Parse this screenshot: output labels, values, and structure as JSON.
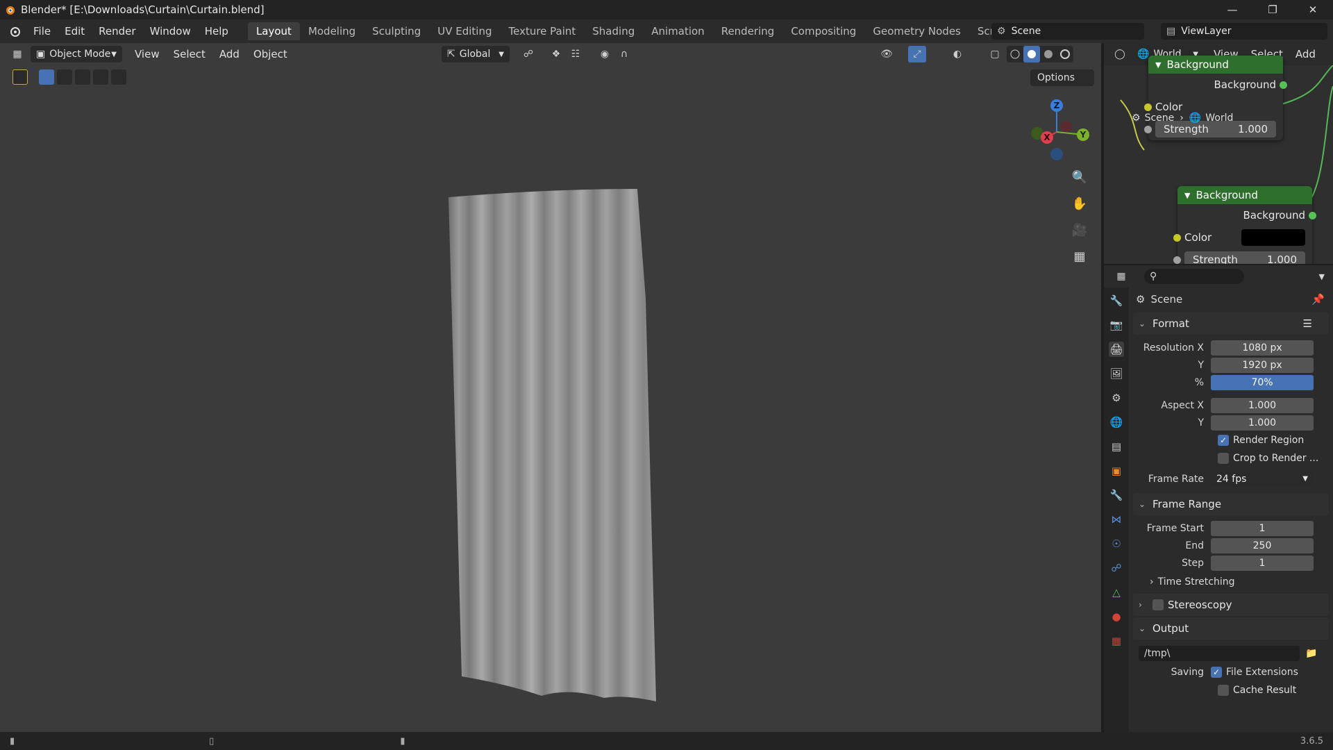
{
  "window": {
    "title": "Blender* [E:\\Downloads\\Curtain\\Curtain.blend]"
  },
  "menu": {
    "items": [
      "File",
      "Edit",
      "Render",
      "Window",
      "Help"
    ]
  },
  "workspaces": {
    "tabs": [
      "Layout",
      "Modeling",
      "Sculpting",
      "UV Editing",
      "Texture Paint",
      "Shading",
      "Animation",
      "Rendering",
      "Compositing",
      "Geometry Nodes",
      "Scripting"
    ],
    "active": "Layout"
  },
  "scene_selector": {
    "scene": "Scene",
    "view_layer": "ViewLayer"
  },
  "viewport": {
    "mode": "Object Mode",
    "menus": [
      "View",
      "Select",
      "Add",
      "Object"
    ],
    "transform_orientation": "Global",
    "options_label": "Options",
    "gizmo_axes": {
      "x": "X",
      "y": "Y",
      "z": "Z"
    }
  },
  "node_editor": {
    "world_type": "World",
    "menus": [
      "View",
      "Select",
      "Add"
    ],
    "breadcrumb": {
      "scene": "Scene",
      "world": "World"
    },
    "node1": {
      "title": "Background",
      "output": "Background",
      "color_label": "Color",
      "strength_label": "Strength",
      "strength_value": "1.000"
    },
    "node2": {
      "title": "Background",
      "output": "Background",
      "color_label": "Color",
      "strength_label": "Strength",
      "strength_value": "1.000"
    }
  },
  "properties": {
    "context": "Scene",
    "format": {
      "title": "Format",
      "res_x_label": "Resolution X",
      "res_x": "1080 px",
      "res_y_label": "Y",
      "res_y": "1920 px",
      "pct_label": "%",
      "pct": "70%",
      "aspect_x_label": "Aspect X",
      "aspect_x": "1.000",
      "aspect_y_label": "Y",
      "aspect_y": "1.000",
      "render_region": "Render Region",
      "crop": "Crop to Render ...",
      "frame_rate_label": "Frame Rate",
      "frame_rate": "24 fps"
    },
    "frame_range": {
      "title": "Frame Range",
      "start_label": "Frame Start",
      "start": "1",
      "end_label": "End",
      "end": "250",
      "step_label": "Step",
      "step": "1"
    },
    "time_stretching": "Time Stretching",
    "stereoscopy": "Stereoscopy",
    "output": {
      "title": "Output",
      "path": "/tmp\\",
      "saving_label": "Saving",
      "file_extensions": "File Extensions",
      "cache_result": "Cache Result"
    }
  },
  "statusbar": {
    "version": "3.6.5"
  },
  "colors": {
    "accent": "#4772b3",
    "node_header": "#2e6f2e",
    "viewport_bg": "#3b3b3b"
  }
}
